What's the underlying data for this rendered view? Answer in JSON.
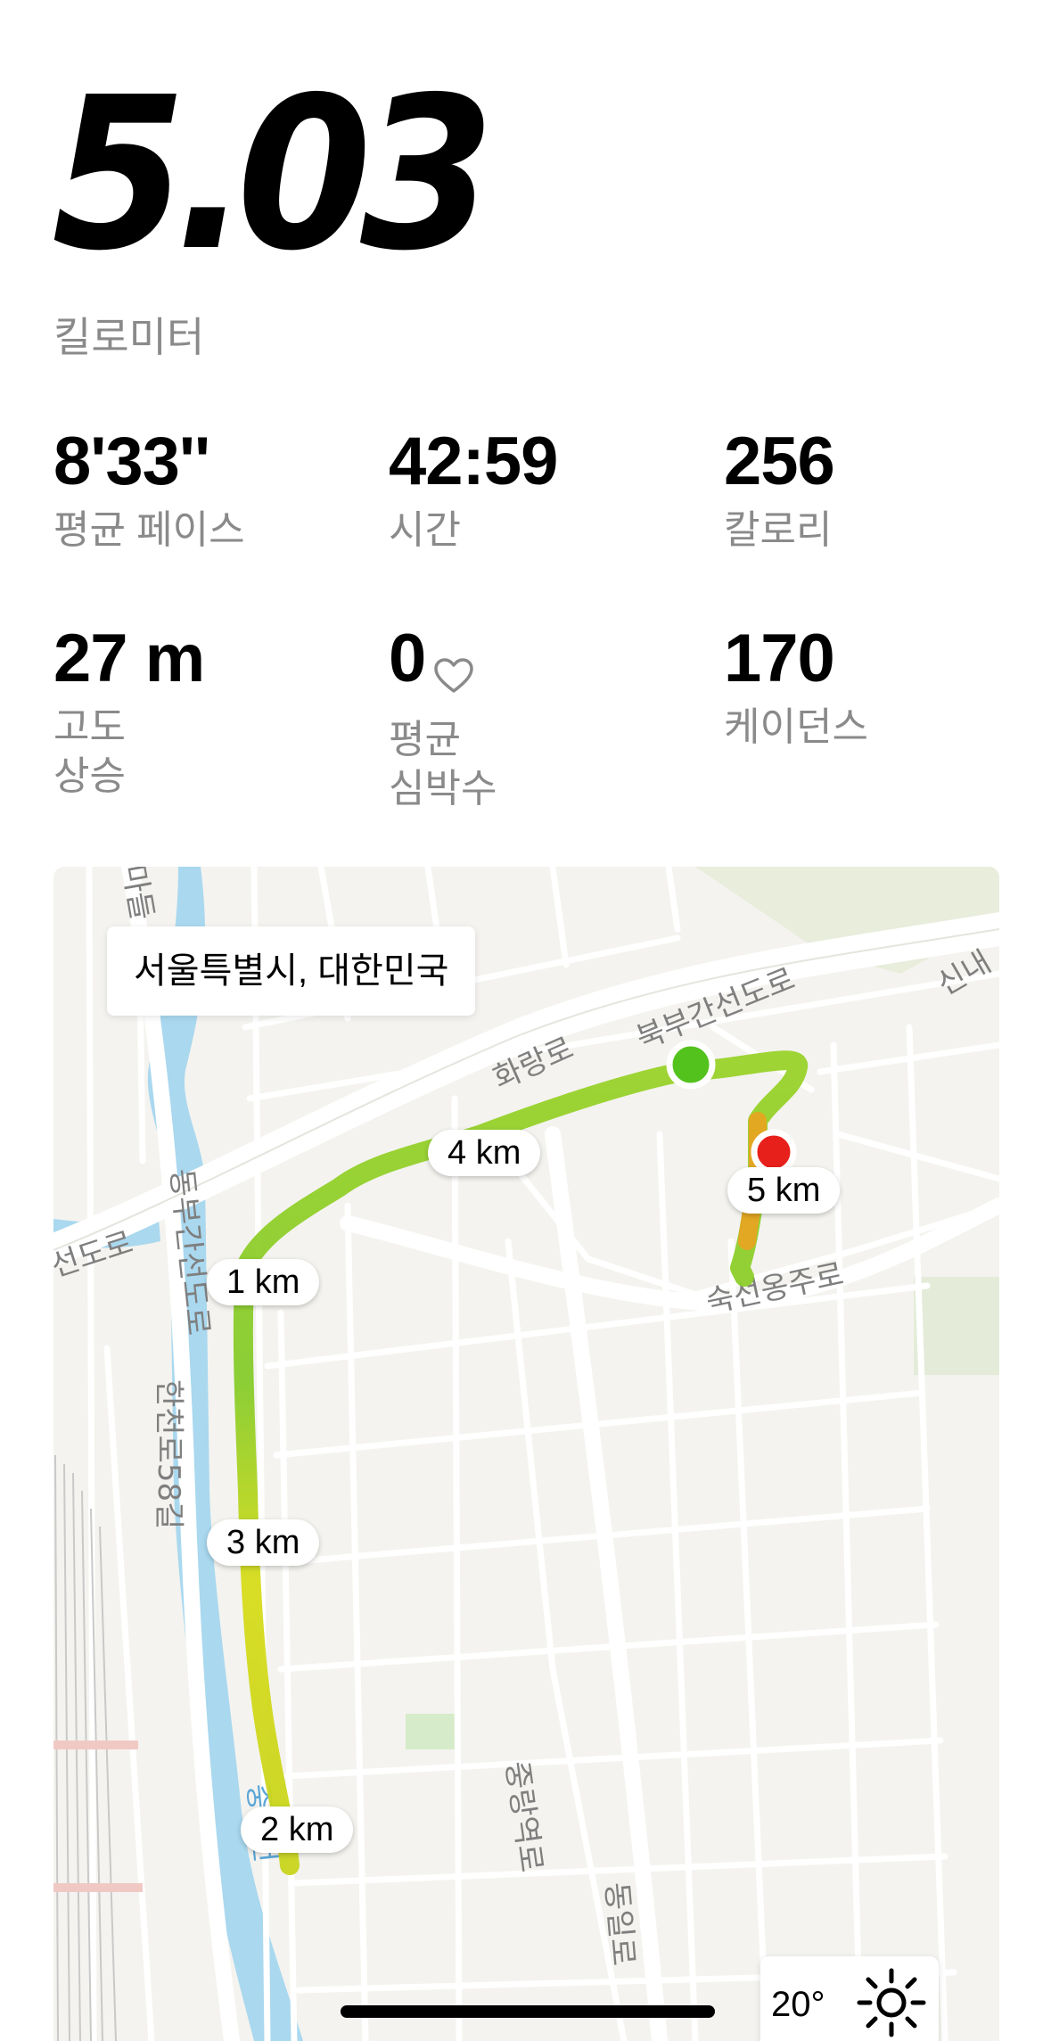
{
  "summary": {
    "distance": "5.03",
    "distance_unit": "킬로미터"
  },
  "stats": [
    {
      "value": "8'33''",
      "label": "평균 페이스"
    },
    {
      "value": "42:59",
      "label": "시간"
    },
    {
      "value": "256",
      "label": "칼로리"
    },
    {
      "value": "27 m",
      "label": "고도\n상승"
    },
    {
      "value": "0",
      "label": "평균\n심박수"
    },
    {
      "value": "170",
      "label": "케이던스"
    }
  ],
  "map": {
    "location": "서울특별시, 대한민국",
    "km_markers": [
      "1 km",
      "2 km",
      "3 km",
      "4 km",
      "5 km"
    ],
    "road_labels": [
      "화랑로",
      "북부간선도로",
      "선도로",
      "동부간선도로",
      "한천로58길",
      "숙선옹주로",
      "중랑역로",
      "동일로",
      "마들",
      "신내",
      "중랑천"
    ],
    "weather": {
      "temperature": "20°",
      "icon": "sun-icon"
    },
    "colors": {
      "route_green": "#8fcf2a",
      "route_yellow": "#d6dc1c",
      "route_orange": "#f0a020",
      "start": "#54c21d",
      "end": "#e8201c",
      "river": "#a9d8ef"
    }
  }
}
